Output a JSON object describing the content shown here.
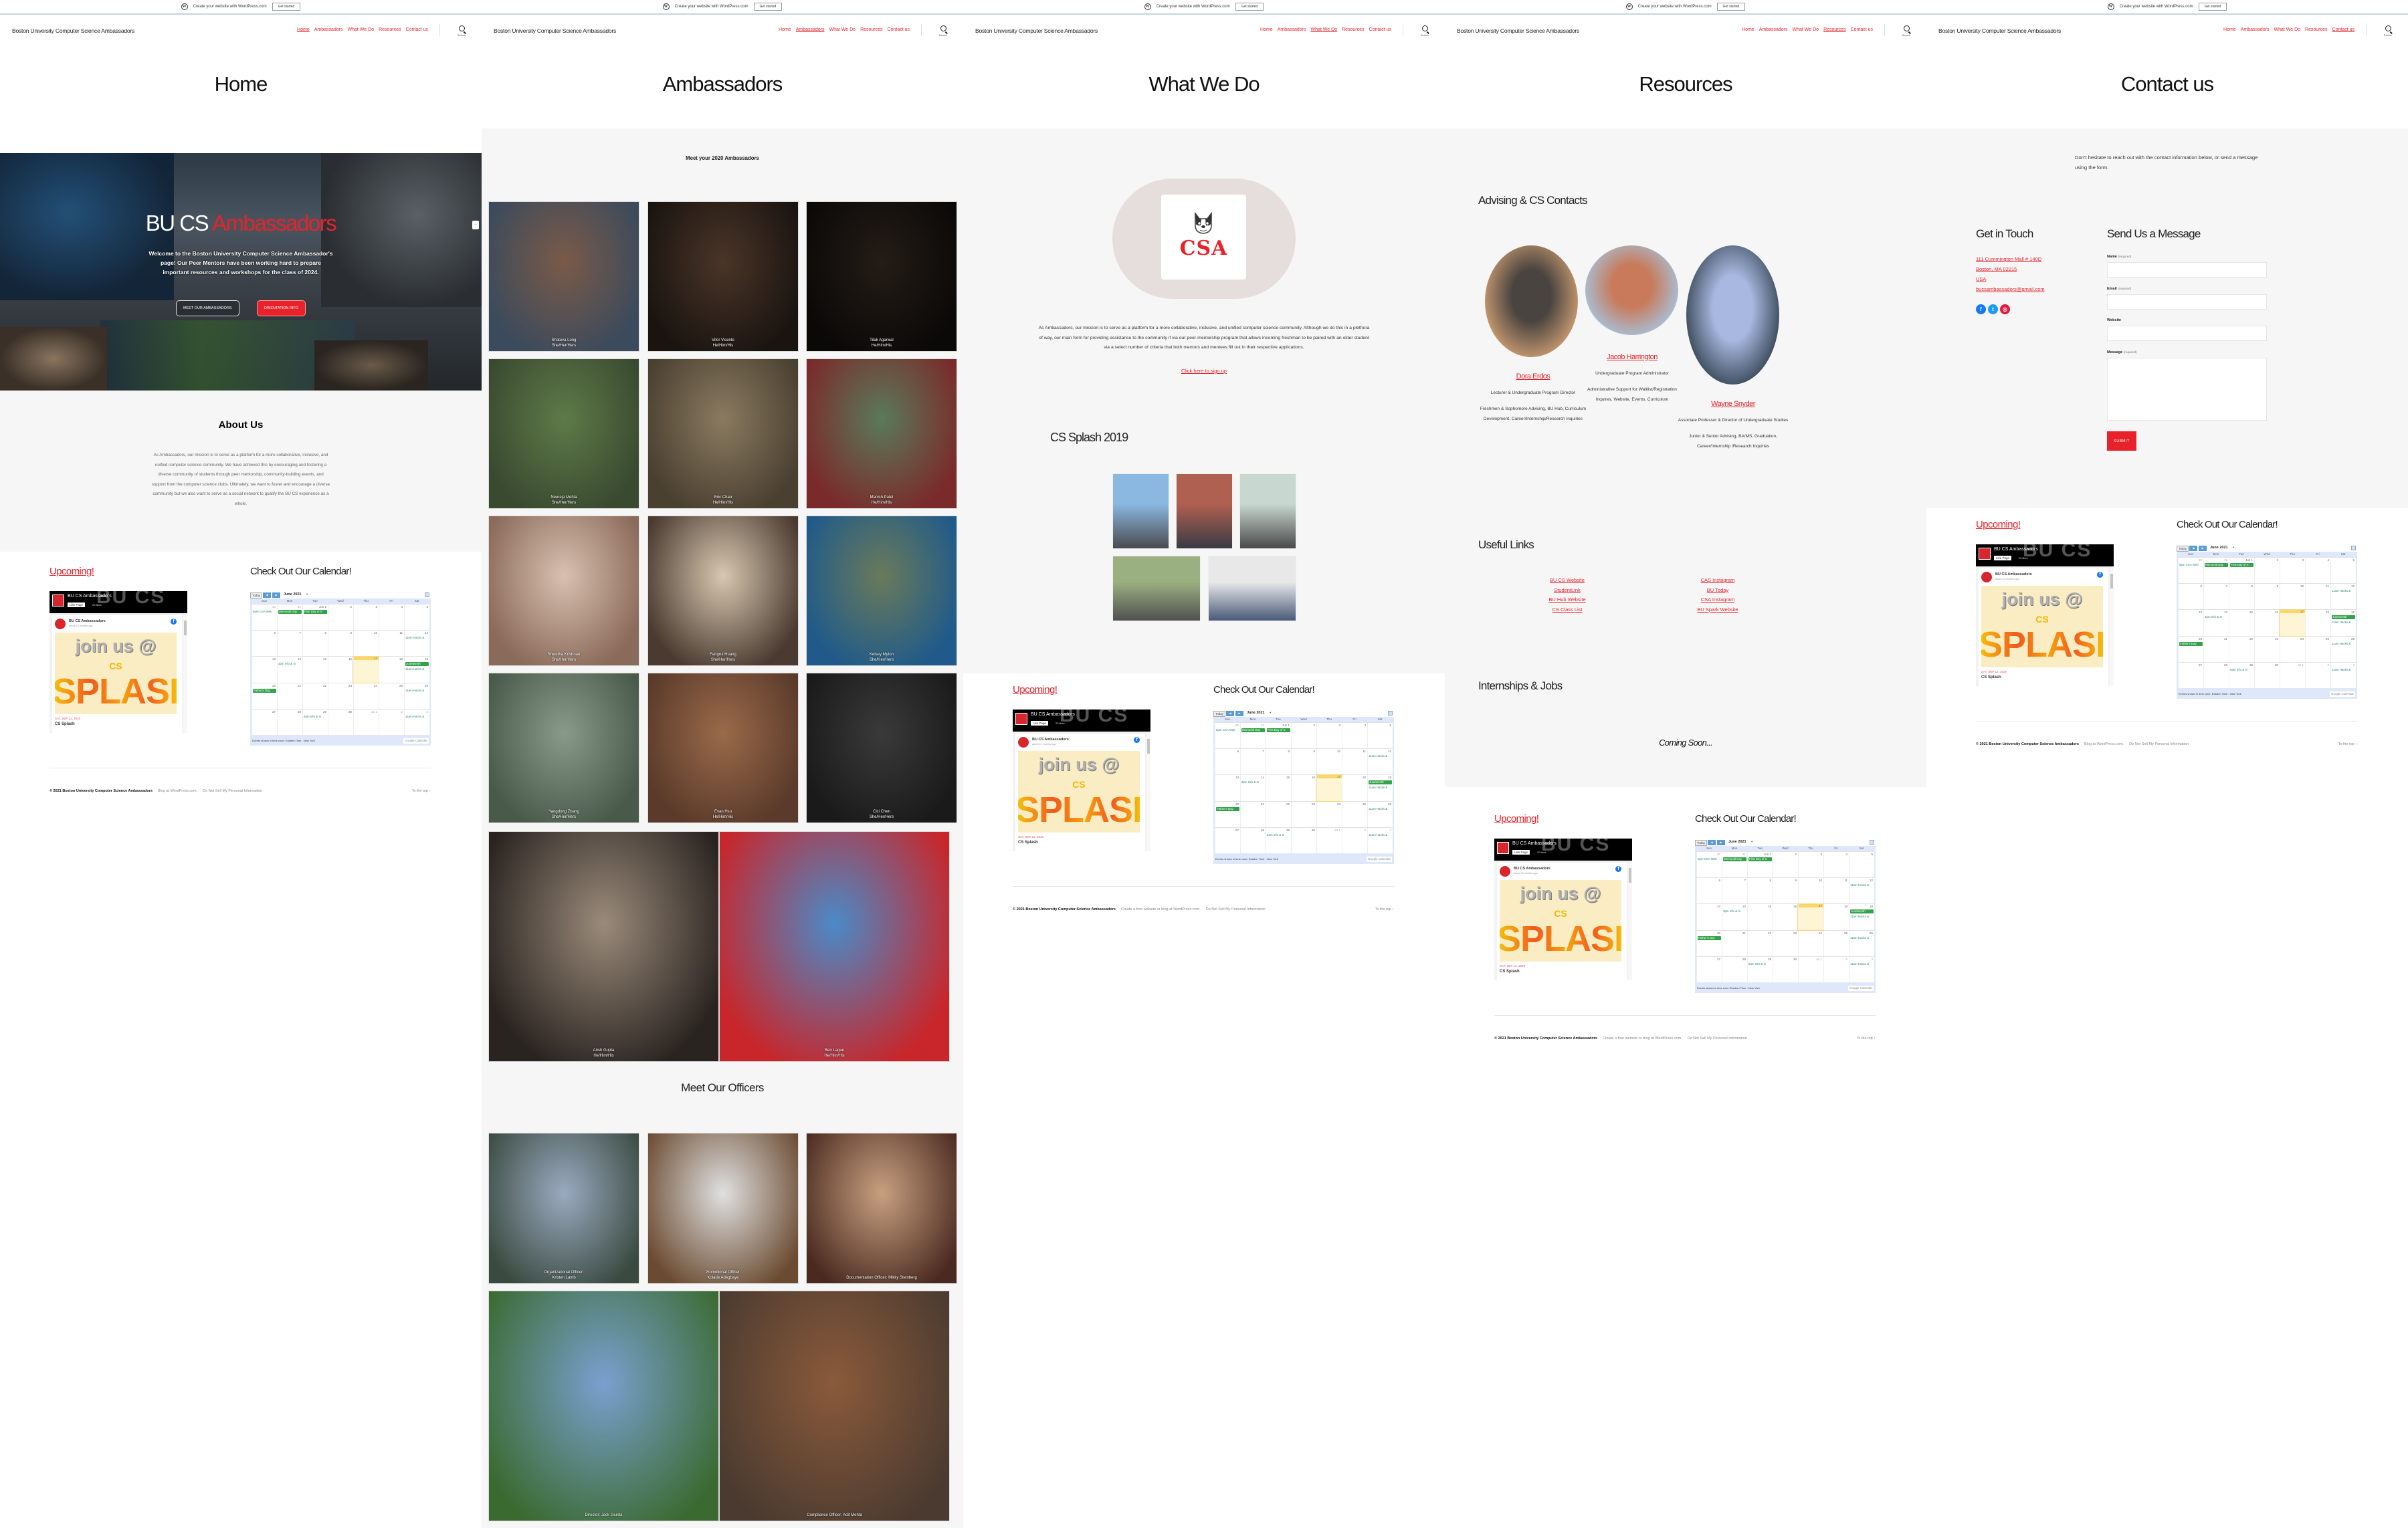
{
  "wp_banner": {
    "text": "Create your website with WordPress.com",
    "button": "Get started"
  },
  "site": {
    "title": "Boston University Computer Science Ambassadors"
  },
  "nav": [
    {
      "label": "Home"
    },
    {
      "label": "Ambassadors"
    },
    {
      "label": "What We Do"
    },
    {
      "label": "Resources"
    },
    {
      "label": "Contact us"
    }
  ],
  "search": {
    "label": "Search"
  },
  "pages": {
    "home": {
      "title": "Home",
      "active_nav": 0
    },
    "ambassadors": {
      "title": "Ambassadors",
      "active_nav": 1
    },
    "what_we_do": {
      "title": "What We Do",
      "active_nav": 2
    },
    "resources": {
      "title": "Resources",
      "active_nav": 3
    },
    "contact": {
      "title": "Contact us",
      "active_nav": 4
    }
  },
  "hero": {
    "title_white": "BU CS",
    "title_red": "Ambassadors",
    "text": "Welcome to the Boston University Computer Science Ambassador's page! Our Peer Mentors have been working hard to prepare important resources and workshops for the class of 2024.",
    "btn_meet": "MEET OUR AMBASSADORS",
    "btn_orientation": "ORIENTATION INFO",
    "more": "···"
  },
  "about": {
    "heading": "About Us",
    "text": "As Ambassadors, our mission is to serve as a platform for a more collaborative, inclusive, and unified computer science community. We have achieved this by encouraging and fostering a diverse community of students through peer mentorship, community-building events, and support from the computer science clubs. Ultimately, we want to foster and encourage a diverse community but we also want to serve as a social network to qualify the BU CS experience as a whole."
  },
  "events": {
    "upcoming": "Upcoming!",
    "calendar_heading": "Check Out Our Calendar!",
    "facebook": {
      "page_name": "BU CS Ambassadors",
      "like_button": "Like Page",
      "likes": "20 likes",
      "post_author": "BU CS Ambassadors",
      "post_time": "about 10 months ago",
      "image_line1": "join us @",
      "image_line2": "CS",
      "image_line3": "SPLASH",
      "event_date": "SAT, SEP 12, 2020",
      "event_name": "CS Splash"
    },
    "calendar": {
      "today_btn": "Today",
      "prev": "◀",
      "next": "▶",
      "month": "June 2021",
      "dows": [
        "Sun",
        "Mon",
        "Tue",
        "Wed",
        "Thu",
        "Fri",
        "Sat"
      ],
      "weeks": [
        [
          {
            "d": "30",
            "o": true,
            "ev": [
              {
                "t": "5pm CSA Web",
                "k": "txt"
              }
            ]
          },
          {
            "d": "31",
            "o": true,
            "ev": [
              {
                "t": "Memorial Day",
                "k": "blk"
              }
            ]
          },
          {
            "d": "Jun 1",
            "ev": [
              {
                "t": "First Day of S",
                "k": "blk"
              }
            ]
          },
          {
            "d": "2"
          },
          {
            "d": "3"
          },
          {
            "d": "4"
          },
          {
            "d": "5"
          }
        ],
        [
          {
            "d": "6"
          },
          {
            "d": "7"
          },
          {
            "d": "8"
          },
          {
            "d": "9"
          },
          {
            "d": "10"
          },
          {
            "d": "11"
          },
          {
            "d": "12",
            "ev": [
              {
                "t": "11am Hacks &",
                "k": "txt"
              }
            ]
          }
        ],
        [
          {
            "d": "13"
          },
          {
            "d": "14",
            "ev": [
              {
                "t": "3pm Info & In",
                "k": "txt"
              }
            ]
          },
          {
            "d": "15"
          },
          {
            "d": "16"
          },
          {
            "d": "17",
            "today": true
          },
          {
            "d": "18"
          },
          {
            "d": "19",
            "ev": [
              {
                "t": "Juneteenth",
                "k": "blk"
              },
              {
                "t": "11am Hacks &",
                "k": "txt"
              }
            ]
          }
        ],
        [
          {
            "d": "20",
            "ev": [
              {
                "t": "Father's Day",
                "k": "blk"
              }
            ]
          },
          {
            "d": "21"
          },
          {
            "d": "22"
          },
          {
            "d": "23"
          },
          {
            "d": "24"
          },
          {
            "d": "25"
          },
          {
            "d": "26",
            "ev": [
              {
                "t": "11am Hacks &",
                "k": "txt"
              }
            ]
          }
        ],
        [
          {
            "d": "27"
          },
          {
            "d": "28"
          },
          {
            "d": "29",
            "ev": [
              {
                "t": "5am Info & In",
                "k": "txt"
              }
            ]
          },
          {
            "d": "30"
          },
          {
            "d": "Jul 1",
            "o": true
          },
          {
            "d": "2",
            "o": true
          },
          {
            "d": "3",
            "o": true,
            "ev": [
              {
                "t": "11am Hacks &",
                "k": "txt"
              }
            ]
          }
        ]
      ],
      "timezone": "Events shown in time zone: Eastern Time - New York",
      "logo": "Google Calendar"
    }
  },
  "footer": {
    "copyright": "© 2021 Boston University Computer Science Ambassadors",
    "blog": "Blog at WordPress.com.",
    "blog_alt": "Create a free website or blog at WordPress.com.",
    "privacy": "Do Not Sell My Personal Information",
    "to_top": "To the top ↑"
  },
  "ambassadors": {
    "heading": "Meet your 2020 Ambassadors",
    "members": [
      {
        "name": "Shateva Long",
        "pronouns": "She/Her/Hers",
        "tone": [
          "#7a5a48",
          "#3b4a5c"
        ]
      },
      {
        "name": "Vitor Vicente",
        "pronouns": "He/Him/His",
        "tone": [
          "#4a3528",
          "#1a1410"
        ]
      },
      {
        "name": "Tilak Agarwal",
        "pronouns": "He/Him/His",
        "tone": [
          "#241c16",
          "#0b0908"
        ]
      },
      {
        "name": "Neereja Mehta",
        "pronouns": "She/Her/Hers",
        "tone": [
          "#5e7a48",
          "#3a4a30"
        ]
      },
      {
        "name": "Eric Chao",
        "pronouns": "He/Him/His",
        "tone": [
          "#8a7a60",
          "#4a4030"
        ]
      },
      {
        "name": "Manish Patel",
        "pronouns": "He/Him/His",
        "tone": [
          "#5a7a5a",
          "#7a2a2a"
        ]
      },
      {
        "name": "Shwetha Krishnan",
        "pronouns": "She/Her/Hers",
        "tone": [
          "#d8c0b0",
          "#8a6a5a"
        ]
      },
      {
        "name": "Fangrui Huang",
        "pronouns": "She/Her/Hers",
        "tone": [
          "#d8c8b0",
          "#4a3a30"
        ]
      },
      {
        "name": "Kelsey Myton",
        "pronouns": "She/Her/Hers",
        "tone": [
          "#6a7a5a",
          "#1f5a8a"
        ]
      },
      {
        "name": "Yangdong Zhang",
        "pronouns": "She/Her/Hers",
        "tone": [
          "#8a9a8a",
          "#4a5a4a"
        ]
      },
      {
        "name": "Evan Hsu",
        "pronouns": "He/Him/His",
        "tone": [
          "#9a6a4a",
          "#5a3a2a"
        ]
      },
      {
        "name": "Cici Chen",
        "pronouns": "She/Her/Hers",
        "tone": [
          "#3a3a3a",
          "#1a1a1a"
        ]
      },
      {
        "name": "Ansh Gupta",
        "pronouns": "He/Him/His",
        "tone": [
          "#9a8a7a",
          "#2a2420"
        ]
      },
      {
        "name": "Ben Lague",
        "pronouns": "He/Him/His",
        "tone": [
          "#4a8ac8",
          "#c8262a"
        ]
      }
    ],
    "officers_heading": "Meet Our Officers",
    "officers": [
      {
        "caption1": "Organizational Officer:",
        "caption2": "Kristen Lamb",
        "tone": [
          "#9aaac0",
          "#3a4a40"
        ]
      },
      {
        "caption1": "Promotional Officer:",
        "caption2": "Kolade Adegbaye",
        "tone": [
          "#e0e0e0",
          "#6a4a30"
        ]
      },
      {
        "caption1": "Documentation Officer: Mikky Steinberg",
        "caption2": "",
        "tone": [
          "#c8a080",
          "#4a2a20"
        ]
      },
      {
        "caption1": "Director: Jack Giunta",
        "caption2": "",
        "tone": [
          "#7aa0d0",
          "#3a6a30"
        ]
      },
      {
        "caption1": "Compliance Officer: Adit Mehta",
        "caption2": "",
        "tone": [
          "#8a5a3a",
          "#4a3a30"
        ]
      }
    ]
  },
  "what_we_do": {
    "logo_text": "CSA",
    "text": "As Ambassadors, our mission is to serve as a platform for a more collaborative, inclusive, and unified computer science community. Although we do this in a plethora of way, our main form for providing assistance to the community if via our peer-mentorship program that allows incoming freshman to be paired with an older student via a select number of criteria that both mentors and mentees fill out in their respective applications.",
    "signup_link": "Click here to sign up",
    "splash_heading": "CS Splash 2019",
    "gallery": [
      {
        "tone": [
          "#8ab8e0",
          "#4a4a50"
        ]
      },
      {
        "tone": [
          "#b06050",
          "#3a3a44"
        ]
      },
      {
        "tone": [
          "#c8d8d0",
          "#4a4a4a"
        ]
      },
      {
        "tone": [
          "#9ab080",
          "#505050"
        ]
      },
      {
        "tone": [
          "#e8e8e8",
          "#4a5a7a"
        ]
      }
    ]
  },
  "resources": {
    "advising_heading": "Advising & CS Contacts",
    "contacts": [
      {
        "name": "Dora Erdos",
        "role": "Lecturer & Undergraduate Program Director",
        "areas": "Freshmen & Sophomore Advising, BU Hub, Curriculum Development, Career/Internship/Research Inquiries",
        "tone": [
          "#c89a70",
          "#4a4440"
        ]
      },
      {
        "name": "Jacob Harrington",
        "role": "Undergraduate Program Administrator",
        "areas": "Administrative Support for Waitlist/Registration Inquires, Website, Events, Curriculum",
        "tone": [
          "#a8c0d8",
          "#c87a5a"
        ]
      },
      {
        "name": "Wayne Snyder",
        "role": "Associate Professor & Director of Undergraduate Studies",
        "areas": "Junior & Senior Advising, BA/MS, Graduation, Career/Internship /Research Inquiries",
        "tone": [
          "#3a4a5a",
          "#a8b8e0"
        ]
      }
    ],
    "links_heading": "Useful Links",
    "links_left": [
      "BU CS Website",
      "StudentLink",
      "BU Hub Website",
      "CS Class List"
    ],
    "links_right": [
      "CAS Instagram",
      "BU Today",
      "CSA Instagram",
      "BU Spark Website"
    ],
    "jobs_heading": "Internships & Jobs",
    "coming_soon": "Coming Soon..."
  },
  "contact": {
    "intro": "Don't hesitate to reach out with the contact information below, or send a message using the form.",
    "get_in_touch": "Get in Touch",
    "address": [
      "111 Cummington Mall # 140D",
      "Boston, MA 02215",
      "USA",
      "bucsambassadors@gmail.com"
    ],
    "social": [
      {
        "name": "facebook",
        "glyph": "f",
        "color": "#1877f2"
      },
      {
        "name": "twitter",
        "glyph": "t",
        "color": "#1d9bf0"
      },
      {
        "name": "instagram",
        "glyph": "◎",
        "color": "#e4173d"
      }
    ],
    "send_heading": "Send Us a Message",
    "form": {
      "name_label": "Name",
      "name_req": "(required)",
      "name_value": "",
      "email_label": "Email",
      "email_req": "(required)",
      "email_value": "",
      "website_label": "Website",
      "website_value": "",
      "message_label": "Message",
      "message_req": "(required)",
      "message_value": "",
      "submit": "SUBMIT"
    }
  },
  "colors": {
    "accent": "#e8222a",
    "bg_gray": "#f6f6f6"
  }
}
